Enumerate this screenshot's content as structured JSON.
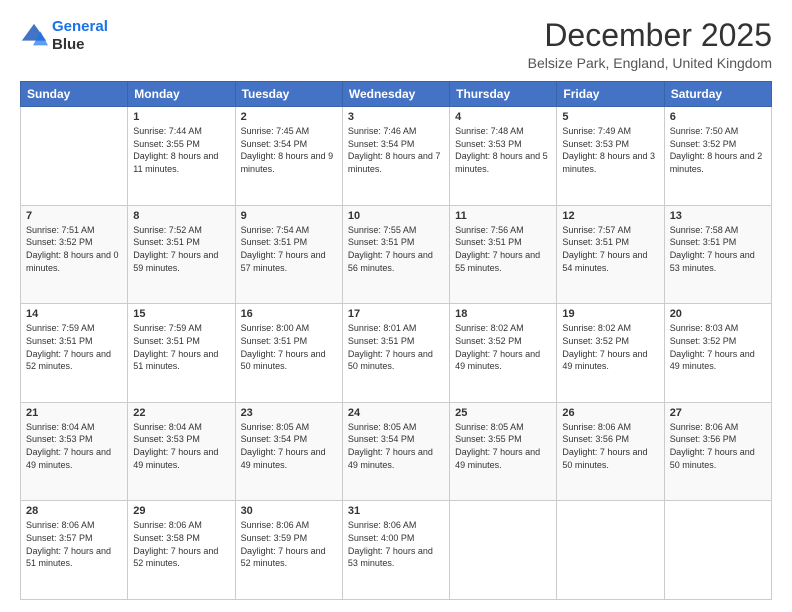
{
  "logo": {
    "line1": "General",
    "line2": "Blue"
  },
  "title": "December 2025",
  "location": "Belsize Park, England, United Kingdom",
  "days_of_week": [
    "Sunday",
    "Monday",
    "Tuesday",
    "Wednesday",
    "Thursday",
    "Friday",
    "Saturday"
  ],
  "weeks": [
    [
      {
        "day": "",
        "sunrise": "",
        "sunset": "",
        "daylight": ""
      },
      {
        "day": "1",
        "sunrise": "Sunrise: 7:44 AM",
        "sunset": "Sunset: 3:55 PM",
        "daylight": "Daylight: 8 hours and 11 minutes."
      },
      {
        "day": "2",
        "sunrise": "Sunrise: 7:45 AM",
        "sunset": "Sunset: 3:54 PM",
        "daylight": "Daylight: 8 hours and 9 minutes."
      },
      {
        "day": "3",
        "sunrise": "Sunrise: 7:46 AM",
        "sunset": "Sunset: 3:54 PM",
        "daylight": "Daylight: 8 hours and 7 minutes."
      },
      {
        "day": "4",
        "sunrise": "Sunrise: 7:48 AM",
        "sunset": "Sunset: 3:53 PM",
        "daylight": "Daylight: 8 hours and 5 minutes."
      },
      {
        "day": "5",
        "sunrise": "Sunrise: 7:49 AM",
        "sunset": "Sunset: 3:53 PM",
        "daylight": "Daylight: 8 hours and 3 minutes."
      },
      {
        "day": "6",
        "sunrise": "Sunrise: 7:50 AM",
        "sunset": "Sunset: 3:52 PM",
        "daylight": "Daylight: 8 hours and 2 minutes."
      }
    ],
    [
      {
        "day": "7",
        "sunrise": "Sunrise: 7:51 AM",
        "sunset": "Sunset: 3:52 PM",
        "daylight": "Daylight: 8 hours and 0 minutes."
      },
      {
        "day": "8",
        "sunrise": "Sunrise: 7:52 AM",
        "sunset": "Sunset: 3:51 PM",
        "daylight": "Daylight: 7 hours and 59 minutes."
      },
      {
        "day": "9",
        "sunrise": "Sunrise: 7:54 AM",
        "sunset": "Sunset: 3:51 PM",
        "daylight": "Daylight: 7 hours and 57 minutes."
      },
      {
        "day": "10",
        "sunrise": "Sunrise: 7:55 AM",
        "sunset": "Sunset: 3:51 PM",
        "daylight": "Daylight: 7 hours and 56 minutes."
      },
      {
        "day": "11",
        "sunrise": "Sunrise: 7:56 AM",
        "sunset": "Sunset: 3:51 PM",
        "daylight": "Daylight: 7 hours and 55 minutes."
      },
      {
        "day": "12",
        "sunrise": "Sunrise: 7:57 AM",
        "sunset": "Sunset: 3:51 PM",
        "daylight": "Daylight: 7 hours and 54 minutes."
      },
      {
        "day": "13",
        "sunrise": "Sunrise: 7:58 AM",
        "sunset": "Sunset: 3:51 PM",
        "daylight": "Daylight: 7 hours and 53 minutes."
      }
    ],
    [
      {
        "day": "14",
        "sunrise": "Sunrise: 7:59 AM",
        "sunset": "Sunset: 3:51 PM",
        "daylight": "Daylight: 7 hours and 52 minutes."
      },
      {
        "day": "15",
        "sunrise": "Sunrise: 7:59 AM",
        "sunset": "Sunset: 3:51 PM",
        "daylight": "Daylight: 7 hours and 51 minutes."
      },
      {
        "day": "16",
        "sunrise": "Sunrise: 8:00 AM",
        "sunset": "Sunset: 3:51 PM",
        "daylight": "Daylight: 7 hours and 50 minutes."
      },
      {
        "day": "17",
        "sunrise": "Sunrise: 8:01 AM",
        "sunset": "Sunset: 3:51 PM",
        "daylight": "Daylight: 7 hours and 50 minutes."
      },
      {
        "day": "18",
        "sunrise": "Sunrise: 8:02 AM",
        "sunset": "Sunset: 3:52 PM",
        "daylight": "Daylight: 7 hours and 49 minutes."
      },
      {
        "day": "19",
        "sunrise": "Sunrise: 8:02 AM",
        "sunset": "Sunset: 3:52 PM",
        "daylight": "Daylight: 7 hours and 49 minutes."
      },
      {
        "day": "20",
        "sunrise": "Sunrise: 8:03 AM",
        "sunset": "Sunset: 3:52 PM",
        "daylight": "Daylight: 7 hours and 49 minutes."
      }
    ],
    [
      {
        "day": "21",
        "sunrise": "Sunrise: 8:04 AM",
        "sunset": "Sunset: 3:53 PM",
        "daylight": "Daylight: 7 hours and 49 minutes."
      },
      {
        "day": "22",
        "sunrise": "Sunrise: 8:04 AM",
        "sunset": "Sunset: 3:53 PM",
        "daylight": "Daylight: 7 hours and 49 minutes."
      },
      {
        "day": "23",
        "sunrise": "Sunrise: 8:05 AM",
        "sunset": "Sunset: 3:54 PM",
        "daylight": "Daylight: 7 hours and 49 minutes."
      },
      {
        "day": "24",
        "sunrise": "Sunrise: 8:05 AM",
        "sunset": "Sunset: 3:54 PM",
        "daylight": "Daylight: 7 hours and 49 minutes."
      },
      {
        "day": "25",
        "sunrise": "Sunrise: 8:05 AM",
        "sunset": "Sunset: 3:55 PM",
        "daylight": "Daylight: 7 hours and 49 minutes."
      },
      {
        "day": "26",
        "sunrise": "Sunrise: 8:06 AM",
        "sunset": "Sunset: 3:56 PM",
        "daylight": "Daylight: 7 hours and 50 minutes."
      },
      {
        "day": "27",
        "sunrise": "Sunrise: 8:06 AM",
        "sunset": "Sunset: 3:56 PM",
        "daylight": "Daylight: 7 hours and 50 minutes."
      }
    ],
    [
      {
        "day": "28",
        "sunrise": "Sunrise: 8:06 AM",
        "sunset": "Sunset: 3:57 PM",
        "daylight": "Daylight: 7 hours and 51 minutes."
      },
      {
        "day": "29",
        "sunrise": "Sunrise: 8:06 AM",
        "sunset": "Sunset: 3:58 PM",
        "daylight": "Daylight: 7 hours and 52 minutes."
      },
      {
        "day": "30",
        "sunrise": "Sunrise: 8:06 AM",
        "sunset": "Sunset: 3:59 PM",
        "daylight": "Daylight: 7 hours and 52 minutes."
      },
      {
        "day": "31",
        "sunrise": "Sunrise: 8:06 AM",
        "sunset": "Sunset: 4:00 PM",
        "daylight": "Daylight: 7 hours and 53 minutes."
      },
      {
        "day": "",
        "sunrise": "",
        "sunset": "",
        "daylight": ""
      },
      {
        "day": "",
        "sunrise": "",
        "sunset": "",
        "daylight": ""
      },
      {
        "day": "",
        "sunrise": "",
        "sunset": "",
        "daylight": ""
      }
    ]
  ]
}
